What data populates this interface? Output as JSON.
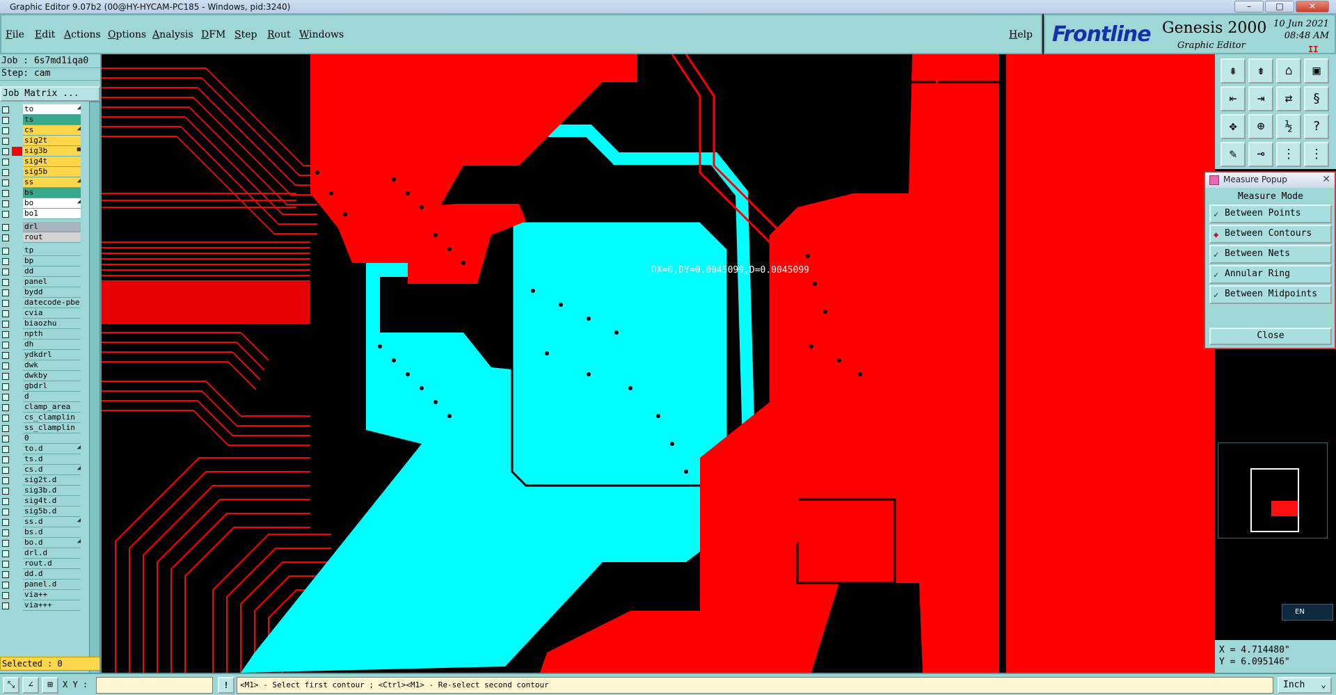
{
  "window": {
    "title": "Graphic Editor 9.07b2 (00@HY-HYCAM-PC185 - Windows, pid:3240)",
    "buttons": [
      "–",
      "□",
      "✕"
    ]
  },
  "menu": [
    "File",
    "Edit",
    "Actions",
    "Options",
    "Analysis",
    "DFM",
    "Step",
    "Rout",
    "Windows"
  ],
  "help": "Help",
  "brand": {
    "logo": "Frontline",
    "product": "Genesis 2000",
    "subtitle": "Graphic Editor",
    "date": "10 Jun 2021",
    "time": "08:48 AM",
    "pause": "II"
  },
  "job": {
    "job_line": "Job : 6s7md1iqa0",
    "step_line": "Step: cam",
    "job_matrix": "Job Matrix ..."
  },
  "layers": [
    {
      "name": "to",
      "color": "#ffffff",
      "mark": "◢"
    },
    {
      "name": "ts",
      "color": "#37a88c",
      "mark": ""
    },
    {
      "name": "cs",
      "color": "#ffd54a",
      "mark": "◢"
    },
    {
      "name": "sig2t",
      "color": "#ffd54a",
      "mark": ""
    },
    {
      "name": "sig3b",
      "color": "#ffd54a",
      "mark": "■"
    },
    {
      "name": "sig4t",
      "color": "#ffd54a",
      "mark": ""
    },
    {
      "name": "sig5b",
      "color": "#ffd54a",
      "mark": ""
    },
    {
      "name": "ss",
      "color": "#ffd54a",
      "mark": "◢"
    },
    {
      "name": "bs",
      "color": "#37a88c",
      "mark": ""
    },
    {
      "name": "bo",
      "color": "#ffffff",
      "mark": "◢"
    },
    {
      "name": "bo1",
      "color": "#ffffff",
      "mark": ""
    },
    {
      "name": "drl",
      "color": "#a7b3bd",
      "mark": ""
    },
    {
      "name": "rout",
      "color": "#d3d3d3",
      "mark": ""
    },
    {
      "name": "tp",
      "color": "#9fd6d6",
      "mark": ""
    },
    {
      "name": "bp",
      "color": "#9fd6d6",
      "mark": ""
    },
    {
      "name": "dd",
      "color": "#9fd6d6",
      "mark": ""
    },
    {
      "name": "panel",
      "color": "#9fd6d6",
      "mark": ""
    },
    {
      "name": "bydd",
      "color": "#9fd6d6",
      "mark": ""
    },
    {
      "name": "datecode-pbe",
      "color": "#9fd6d6",
      "mark": ""
    },
    {
      "name": "cvia",
      "color": "#9fd6d6",
      "mark": ""
    },
    {
      "name": "biaozhu",
      "color": "#9fd6d6",
      "mark": ""
    },
    {
      "name": "npth",
      "color": "#9fd6d6",
      "mark": ""
    },
    {
      "name": "dh",
      "color": "#9fd6d6",
      "mark": ""
    },
    {
      "name": "ydkdrl",
      "color": "#9fd6d6",
      "mark": ""
    },
    {
      "name": "dwk",
      "color": "#9fd6d6",
      "mark": ""
    },
    {
      "name": "dwkby",
      "color": "#9fd6d6",
      "mark": ""
    },
    {
      "name": "gbdrl",
      "color": "#9fd6d6",
      "mark": ""
    },
    {
      "name": "d",
      "color": "#9fd6d6",
      "mark": ""
    },
    {
      "name": "clamp_area",
      "color": "#9fd6d6",
      "mark": ""
    },
    {
      "name": "cs_clamplin",
      "color": "#9fd6d6",
      "mark": ""
    },
    {
      "name": "ss_clamplin",
      "color": "#9fd6d6",
      "mark": ""
    },
    {
      "name": "0",
      "color": "#9fd6d6",
      "mark": ""
    },
    {
      "name": "to.d",
      "color": "#9fd6d6",
      "mark": "◢"
    },
    {
      "name": "ts.d",
      "color": "#9fd6d6",
      "mark": ""
    },
    {
      "name": "cs.d",
      "color": "#9fd6d6",
      "mark": "◢"
    },
    {
      "name": "sig2t.d",
      "color": "#9fd6d6",
      "mark": ""
    },
    {
      "name": "sig3b.d",
      "color": "#9fd6d6",
      "mark": ""
    },
    {
      "name": "sig4t.d",
      "color": "#9fd6d6",
      "mark": ""
    },
    {
      "name": "sig5b.d",
      "color": "#9fd6d6",
      "mark": ""
    },
    {
      "name": "ss.d",
      "color": "#9fd6d6",
      "mark": "◢"
    },
    {
      "name": "bs.d",
      "color": "#9fd6d6",
      "mark": ""
    },
    {
      "name": "bo.d",
      "color": "#9fd6d6",
      "mark": "◢"
    },
    {
      "name": "drl.d",
      "color": "#9fd6d6",
      "mark": ""
    },
    {
      "name": "rout.d",
      "color": "#9fd6d6",
      "mark": ""
    },
    {
      "name": "dd.d",
      "color": "#9fd6d6",
      "mark": ""
    },
    {
      "name": "panel.d",
      "color": "#9fd6d6",
      "mark": ""
    },
    {
      "name": "via++",
      "color": "#9fd6d6",
      "mark": ""
    },
    {
      "name": "via+++",
      "color": "#9fd6d6",
      "mark": ""
    }
  ],
  "selected": "Selected : 0",
  "measure_readout": "DX=0,DY=0.0045099,D=0.0045099",
  "popup": {
    "title": "Measure Popup",
    "mode_label": "Measure Mode",
    "options": [
      {
        "label": "Between Points",
        "selected": false
      },
      {
        "label": "Between Contours",
        "selected": true
      },
      {
        "label": "Between Nets",
        "selected": false
      },
      {
        "label": "Annular Ring",
        "selected": false
      },
      {
        "label": "Between Midpoints",
        "selected": false
      }
    ],
    "close": "Close"
  },
  "coords": {
    "x": "X = 4.714480\"",
    "y": "Y = 6.095146\""
  },
  "lang": "EN",
  "status": {
    "xy_label": "X Y :",
    "xy_value": "",
    "prompt": "<M1> - Select first contour ; <Ctrl><M1> - Re-select second contour",
    "units": "Inch"
  },
  "colors": {
    "panel": "#9fd6d6",
    "copper": "#ff0000",
    "highlight": "#00ffff",
    "background": "#000000"
  }
}
